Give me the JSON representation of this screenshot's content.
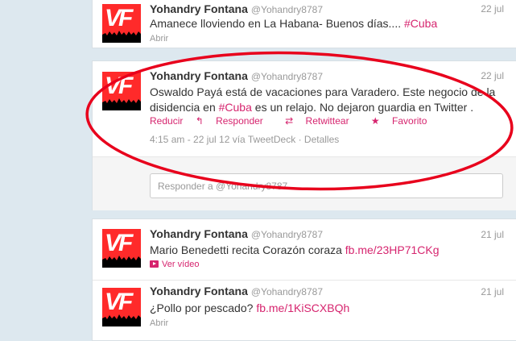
{
  "tweets": [
    {
      "name": "Yohandry Fontana",
      "handle": "@Yohandry8787",
      "date": "22 jul",
      "text_plain": "Amanece lloviendo en La Habana- Buenos días.... ",
      "hashtag": "#Cuba",
      "action": "Abrir"
    },
    {
      "name": "Yohandry Fontana",
      "handle": "@Yohandry8787",
      "date": "22 jul",
      "text_part1": "Oswaldo Payá está de vacaciones para Varadero. Este negocio de la disidencia en ",
      "hashtag": "#Cuba",
      "text_part2": " es un relajo. No dejaron guardia en Twitter .",
      "actions": {
        "collapse": "Reducir",
        "reply": "Responder",
        "retweet": "Retwittear",
        "favorite": "Favorito"
      },
      "timestamp": "4:15 am - 22 jul 12 vía TweetDeck",
      "details": "Detalles",
      "reply_placeholder": "Responder a @Yohandry8787"
    },
    {
      "name": "Yohandry Fontana",
      "handle": "@Yohandry8787",
      "date": "21 jul",
      "text_plain": "Mario Benedetti recita Corazón coraza ",
      "link": "fb.me/23HP71CKg",
      "action": "Ver vídeo"
    },
    {
      "name": "Yohandry Fontana",
      "handle": "@Yohandry8787",
      "date": "21 jul",
      "text_plain": "¿Pollo por pescado? ",
      "link": "fb.me/1KiSCXBQh",
      "action": "Abrir"
    }
  ],
  "colors": {
    "accent": "#d6246e",
    "annotation": "#e8001c",
    "avatar_bg": "#ff2a2a",
    "page_bg": "#dde8ef"
  }
}
